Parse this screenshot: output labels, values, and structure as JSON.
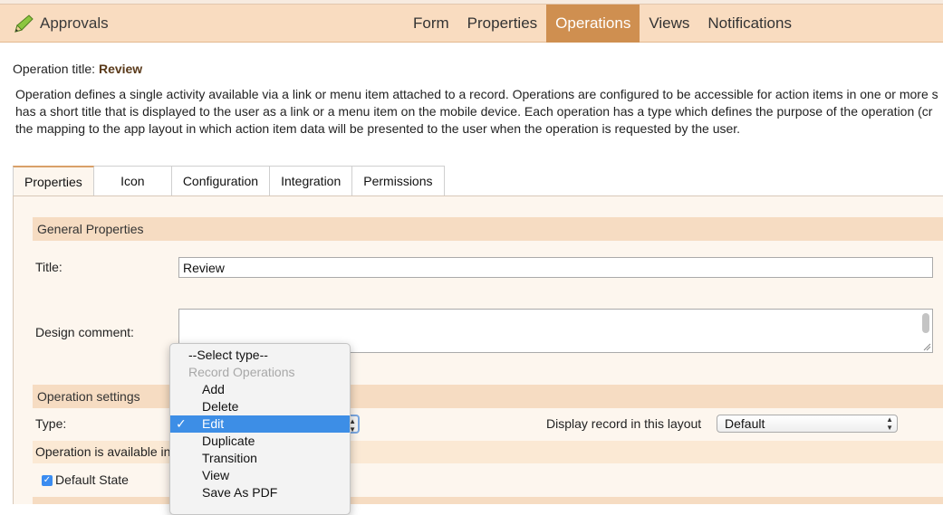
{
  "header": {
    "app_title": "Approvals",
    "nav": [
      {
        "label": "Form",
        "active": false
      },
      {
        "label": "Properties",
        "active": false
      },
      {
        "label": "Operations",
        "active": true
      },
      {
        "label": "Views",
        "active": false
      },
      {
        "label": "Notifications",
        "active": false
      }
    ]
  },
  "operation": {
    "title_label": "Operation title:",
    "title_value": "Review",
    "description_lines": [
      "Operation defines a single activity available via a link or menu item attached to a record. Operations are configured to be accessible for action items in one or more s",
      "has a short title that is displayed to the user as a link or a menu item on the mobile device. Each operation has a type which defines the purpose of the operation (cr",
      "the mapping to the app layout in which action item data will be presented to the user when the operation is requested by the user."
    ]
  },
  "tabs": [
    "Properties",
    "Icon",
    "Configuration",
    "Integration",
    "Permissions"
  ],
  "general": {
    "section_title": "General Properties",
    "title_label": "Title:",
    "title_value": "Review",
    "comment_label": "Design comment:",
    "comment_value": ""
  },
  "settings": {
    "section_title": "Operation settings",
    "type_label": "Type:",
    "layout_label": "Display record in this layout",
    "layout_value": "Default",
    "available_label": "Operation is available in",
    "default_state_label": "Default State",
    "default_state_checked": true
  },
  "dropdown": {
    "placeholder": "--Select type--",
    "group_label": "Record Operations",
    "options": [
      "Add",
      "Delete",
      "Edit",
      "Duplicate",
      "Transition",
      "View",
      "Save As PDF"
    ],
    "selected": "Edit",
    "check_mark": "✓"
  },
  "icons": {
    "app": "pencil-arrow-icon",
    "select_arrows": "up-down-arrows-icon"
  },
  "colors": {
    "header_bg": "#f9dcc0",
    "nav_active_bg": "#cf8f50",
    "section_bg": "#f6dcc2",
    "panel_bg": "#fdf6ee",
    "selection_blue": "#3d8ee6"
  }
}
